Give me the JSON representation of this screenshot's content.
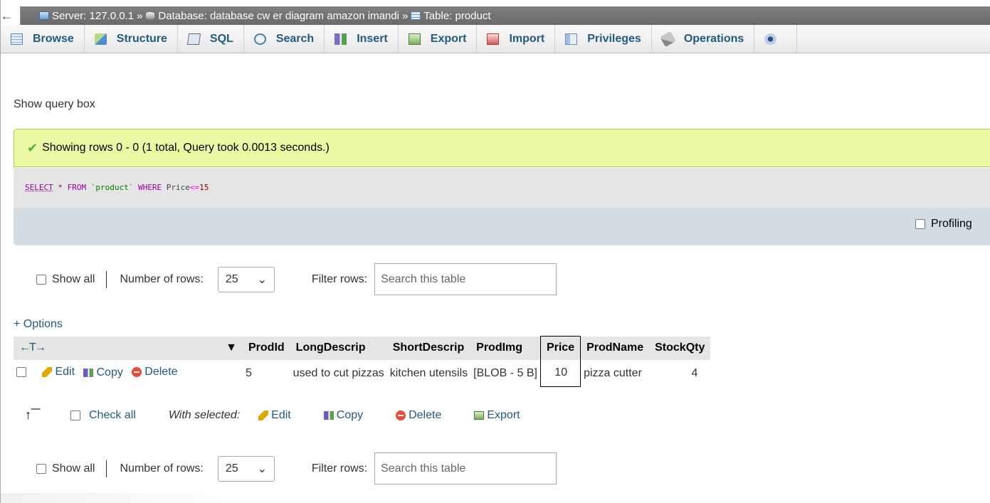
{
  "breadcrumb": {
    "back": "←",
    "server": "Server: 127.0.0.1",
    "database": "Database: database cw er diagram amazon imandi",
    "table": "Table: product",
    "sep": "»"
  },
  "tabs": [
    {
      "label": "Browse",
      "icon": "browse-icon"
    },
    {
      "label": "Structure",
      "icon": "structure-icon"
    },
    {
      "label": "SQL",
      "icon": "sql-icon"
    },
    {
      "label": "Search",
      "icon": "search-icon"
    },
    {
      "label": "Insert",
      "icon": "insert-icon"
    },
    {
      "label": "Export",
      "icon": "export-icon"
    },
    {
      "label": "Import",
      "icon": "import-icon"
    },
    {
      "label": "Privileges",
      "icon": "privileges-icon"
    },
    {
      "label": "Operations",
      "icon": "operations-icon"
    }
  ],
  "show_query_box": "Show query box",
  "notice": {
    "text": "Showing rows 0 - 0 (1 total, Query took 0.0013 seconds.)",
    "color": "#ebf8a4"
  },
  "query": {
    "select": "SELECT",
    "star": "*",
    "from": "FROM",
    "table": "`product`",
    "where": "WHERE",
    "field": "Price",
    "op": "<=",
    "value": "15"
  },
  "profiling": "Profiling",
  "nav_top": {
    "show_all": "Show all",
    "rows_label": "Number of rows:",
    "rows_value": "25",
    "filter_label": "Filter rows:",
    "filter_placeholder": "Search this table"
  },
  "options_link": "+ Options",
  "table": {
    "arrows": "←T→",
    "sort_icon": "▼",
    "columns": [
      "ProdId",
      "LongDescrip",
      "ShortDescrip",
      "ProdImg",
      "Price",
      "ProdName",
      "StockQty"
    ],
    "row": {
      "edit": "Edit",
      "copy": "Copy",
      "delete": "Delete",
      "ProdId": "5",
      "LongDescrip": "used to cut pizzas",
      "ShortDescrip": "kitchen utensils",
      "ProdImg": "[BLOB - 5 B]",
      "Price": "10",
      "ProdName": "pizza cutter",
      "StockQty": "4"
    }
  },
  "bulk": {
    "check_all": "Check all",
    "with_selected": "With selected:",
    "edit": "Edit",
    "copy": "Copy",
    "delete": "Delete",
    "export": "Export"
  },
  "nav_bottom": {
    "show_all": "Show all",
    "rows_label": "Number of rows:",
    "rows_value": "25",
    "filter_label": "Filter rows:",
    "filter_placeholder": "Search this table"
  }
}
